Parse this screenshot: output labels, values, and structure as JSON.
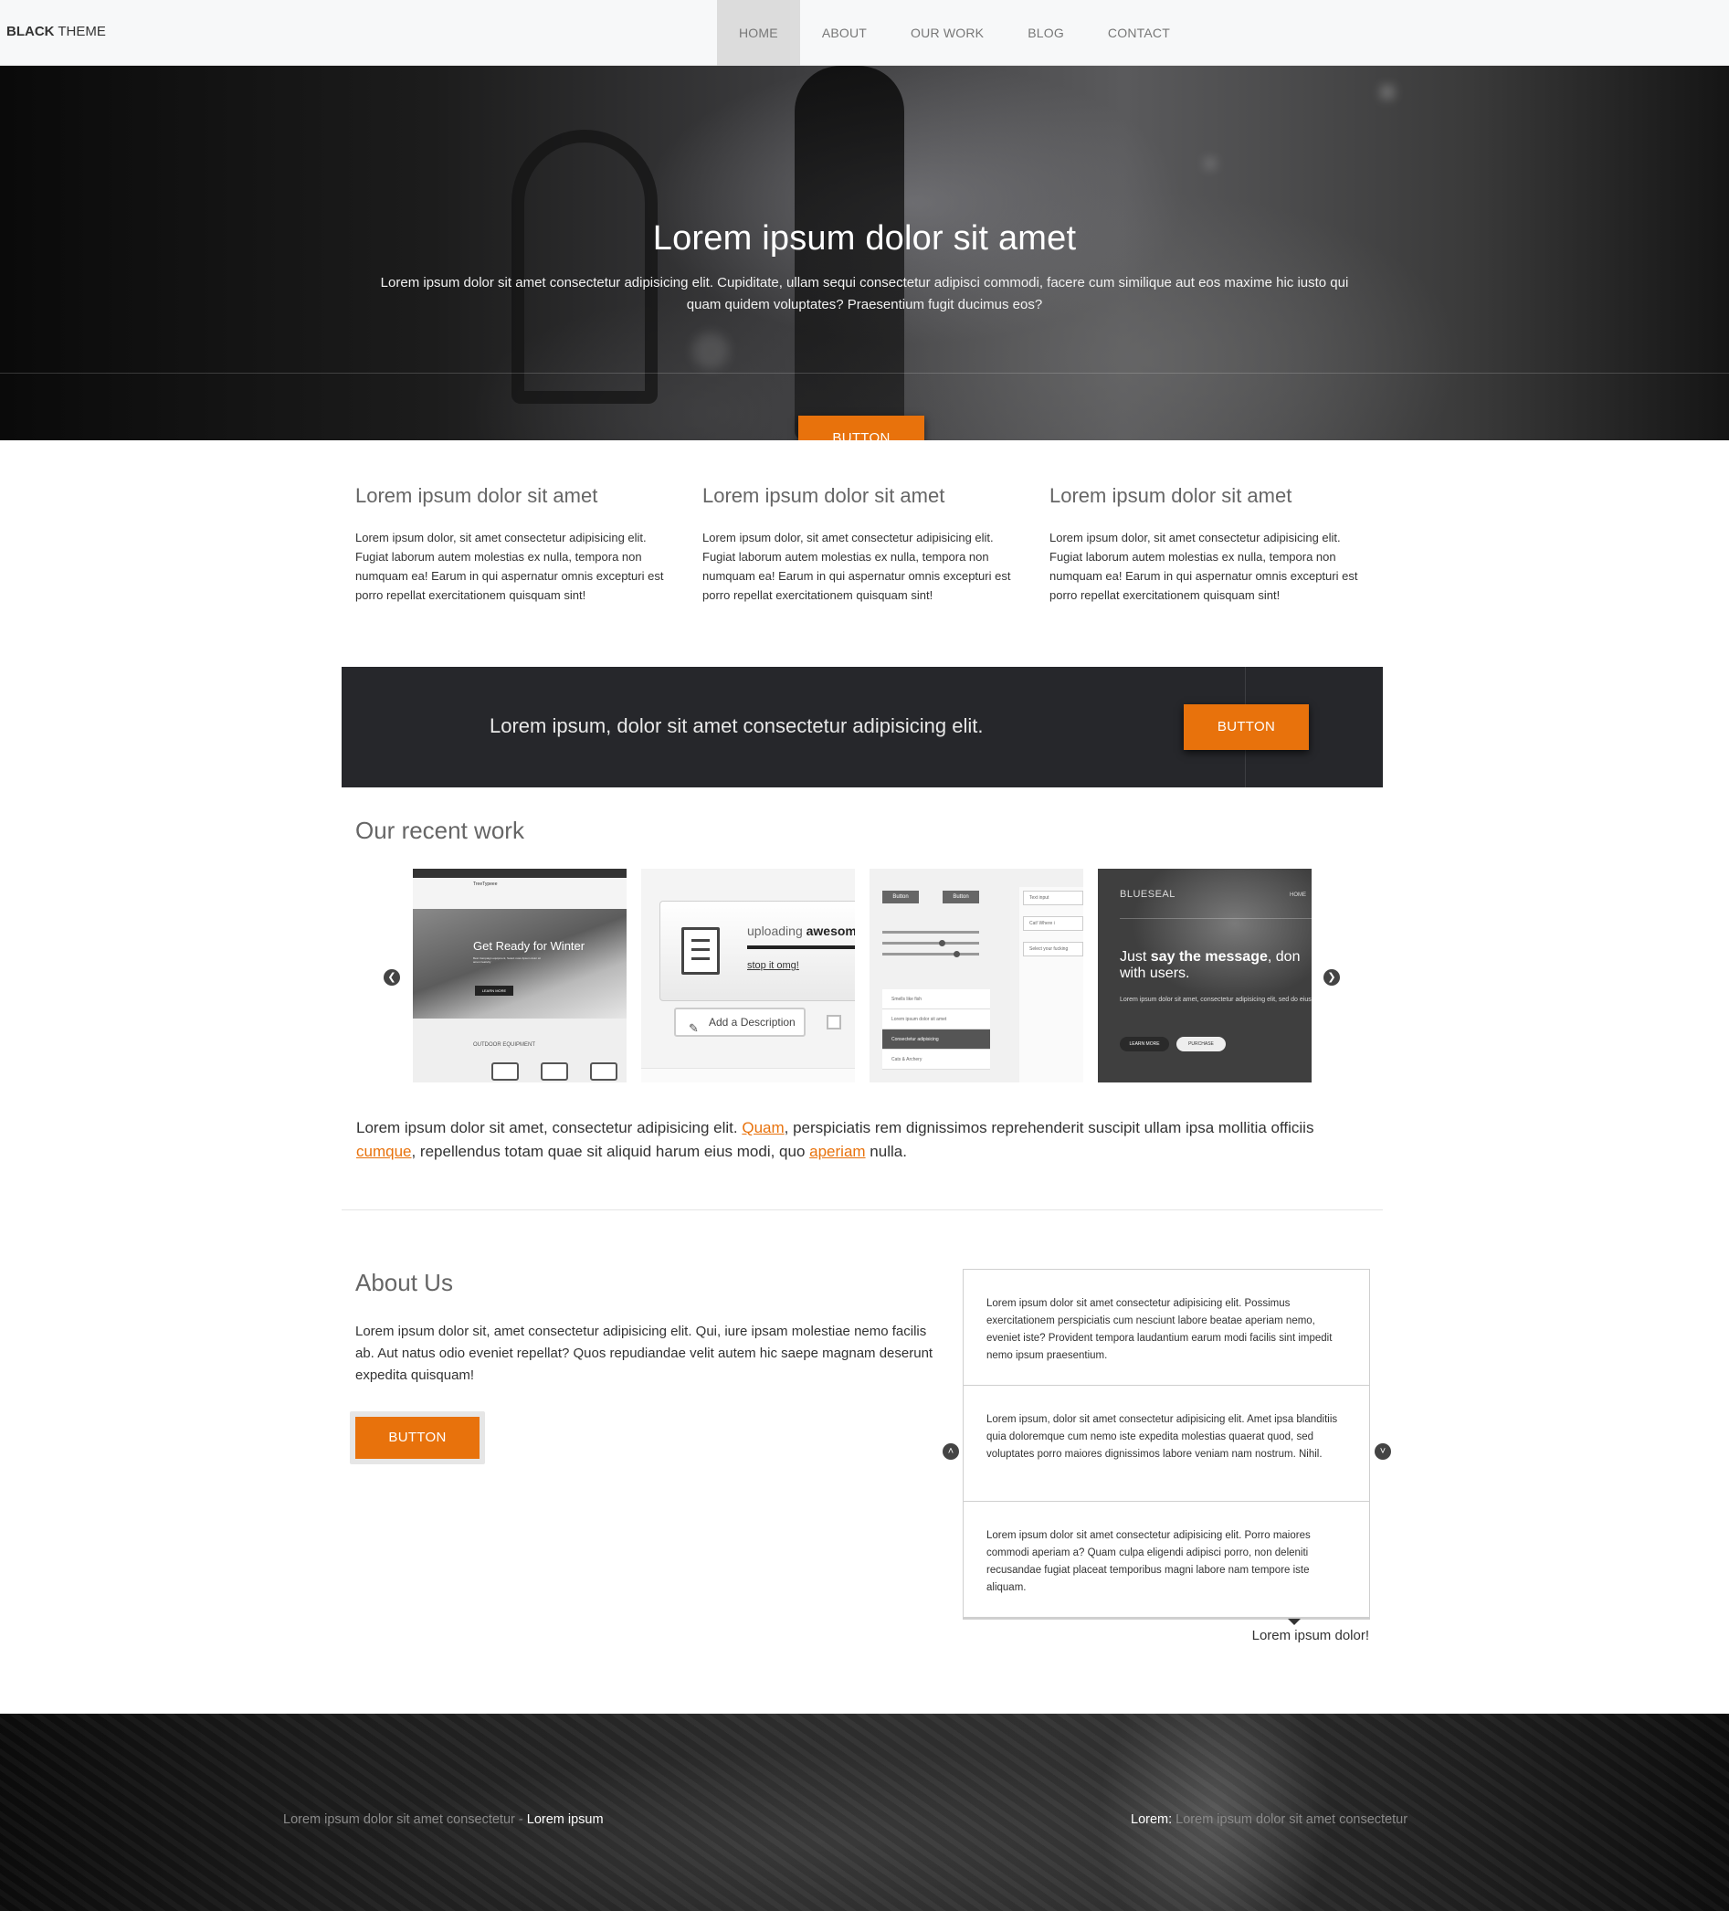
{
  "brand": {
    "strong": "BLACK",
    "rest": " THEME"
  },
  "nav": [
    {
      "label": "HOME",
      "active": true
    },
    {
      "label": "ABOUT"
    },
    {
      "label": "OUR WORK"
    },
    {
      "label": "BLOG"
    },
    {
      "label": "CONTACT"
    }
  ],
  "hero": {
    "title": "Lorem ipsum dolor sit amet",
    "text": "Lorem ipsum dolor sit amet consectetur adipisicing elit. Cupiditate, ullam sequi consectetur adipisci commodi, facere cum similique aut eos maxime hic iusto qui quam quidem voluptates? Praesentium fugit ducimus eos?",
    "button": "BUTTON"
  },
  "features": [
    {
      "title": "Lorem ipsum dolor sit amet",
      "text": "Lorem ipsum dolor, sit amet consectetur adipisicing elit. Fugiat laborum autem molestias ex nulla, tempora non numquam ea! Earum in qui aspernatur omnis excepturi est porro repellat exercitationem quisquam sint!"
    },
    {
      "title": "Lorem ipsum dolor sit amet",
      "text": "Lorem ipsum dolor, sit amet consectetur adipisicing elit. Fugiat laborum autem molestias ex nulla, tempora non numquam ea! Earum in qui aspernatur omnis excepturi est porro repellat exercitationem quisquam sint!"
    },
    {
      "title": "Lorem ipsum dolor sit amet",
      "text": "Lorem ipsum dolor, sit amet consectetur adipisicing elit. Fugiat laborum autem molestias ex nulla, tempora non numquam ea! Earum in qui aspernatur omnis excepturi est porro repellat exercitationem quisquam sint!"
    }
  ],
  "cta": {
    "text": "Lorem ipsum, dolor sit amet consectetur adipisicing elit.",
    "button": "BUTTON"
  },
  "work": {
    "title": "Our recent work",
    "thumbs": {
      "t1": {
        "logo": "TreeTypeee",
        "headline": "Get Ready for Winter",
        "sub": "Best Campaign equipment, Select more lipsum dolor sit amet creativity",
        "button": "LEARN MORE",
        "section": "OUTDOOR EQUIPMENT"
      },
      "t2": {
        "uploading": "uploading ",
        "uploading_bold": "awesome",
        "stop": "stop it omg!",
        "add": "Add a Description"
      },
      "t3": {
        "btn1": "Button",
        "btn2": "Button",
        "input1": "Text input",
        "input2": "Cat! Where i",
        "input3": "Select your fucking",
        "list": [
          "Smells like fish",
          "Lorem ipsum dolor sit amet",
          "Consectetur adipisicing",
          "Cats & Archery"
        ]
      },
      "t4": {
        "brand": "BLUESEAL",
        "home": "HOME",
        "msg_pre": "Just ",
        "msg_bold": "say the message",
        "msg_post": ", don",
        "msg_line2": "with users.",
        "small": "Lorem ipsum dolor sit amet, consectetur adipisicing elit, sed do eiusmod tempor incididunt ut labore et dolore magna",
        "learn": "LEARN MORE",
        "purchase": "PURCHASE"
      }
    },
    "desc": {
      "p1": "Lorem ipsum dolor sit amet, consectetur adipisicing elit. ",
      "l1": "Quam",
      "p2": ", perspiciatis rem dignissimos reprehenderit suscipit ullam ipsa mollitia officiis ",
      "l2": "cumque",
      "p3": ", repellendus totam quae sit aliquid harum eius modi, quo ",
      "l3": "aperiam",
      "p4": " nulla."
    }
  },
  "about": {
    "title": "About Us",
    "text": "Lorem ipsum dolor sit, amet consectetur adipisicing elit. Qui, iure ipsam molestiae nemo facilis ab. Aut natus odio eveniet repellat? Quos repudiandae velit autem hic saepe magnam deserunt expedita quisquam!",
    "button": "BUTTON"
  },
  "testimonials": {
    "items": [
      "Lorem ipsum dolor sit amet consectetur adipisicing elit. Possimus exercitationem perspiciatis cum nesciunt labore beatae aperiam nemo, eveniet iste? Provident tempora laudantium earum modi facilis sint impedit nemo ipsum praesentium.",
      "Lorem ipsum, dolor sit amet consectetur adipisicing elit. Amet ipsa blanditiis quia doloremque cum nemo iste expedita molestias quaerat quod, sed voluptates porro maiores dignissimos labore veniam nam nostrum. Nihil.",
      "Lorem ipsum dolor sit amet consectetur adipisicing elit. Porro maiores commodi aperiam a? Quam culpa eligendi adipisci porro, non deleniti recusandae fugiat placeat temporibus magni labore nam tempore iste aliquam."
    ],
    "author": "Lorem ipsum dolor!"
  },
  "footer": {
    "left_text": "Lorem ipsum dolor sit amet consectetur - ",
    "left_strong": "Lorem ipsum",
    "right_strong": "Lorem:",
    "right_text": " Lorem ipsum dolor sit amet consectetur"
  },
  "colors": {
    "accent": "#e8720c",
    "dark_band": "#26272b"
  },
  "icons": {
    "prev": "chevron-left-circle-icon",
    "next": "chevron-right-circle-icon",
    "up": "chevron-up-circle-icon",
    "down": "chevron-down-circle-icon"
  }
}
